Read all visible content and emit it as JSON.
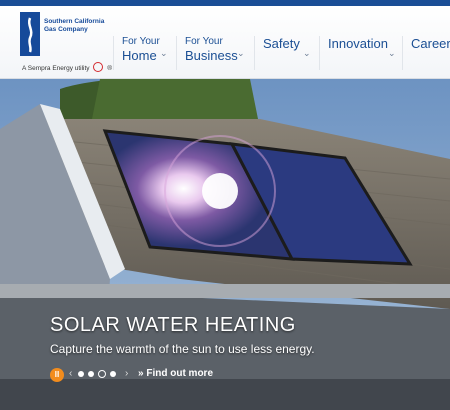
{
  "logo": {
    "company": "Southern California Gas Company",
    "tagline": "A Sempra Energy utility",
    "tagline_suffix": "®",
    "brand_color": "#164a9a",
    "sempra_color": "#d4282e"
  },
  "nav": {
    "items": [
      {
        "pre": "For Your",
        "label": "Home",
        "icon": "chevron-down-icon"
      },
      {
        "pre": "For Your",
        "label": "Business",
        "icon": "chevron-down-icon"
      },
      {
        "pre": "",
        "label": "Safety",
        "icon": "chevron-down-icon"
      },
      {
        "pre": "",
        "label": "Innovation",
        "icon": "chevron-down-icon"
      },
      {
        "pre": "",
        "label": "Careers",
        "icon": "chevron-down-icon"
      }
    ]
  },
  "hero": {
    "title": "SOLAR WATER HEATING",
    "subtitle": "Capture the warmth of the sun to use less energy.",
    "pause_label": "II",
    "cta_label": "» Find out more",
    "prev_icon": "‹",
    "next_icon": "›",
    "slides": 4,
    "active_slide": 3,
    "accent": "#f28c1d"
  }
}
